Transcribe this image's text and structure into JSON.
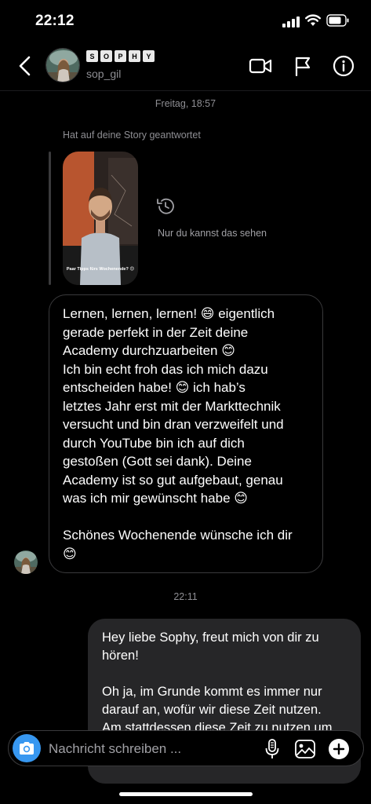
{
  "status_bar": {
    "time": "22:12"
  },
  "header": {
    "display_name_letters": [
      "S",
      "O",
      "P",
      "H",
      "Y"
    ],
    "username": "sop_gil",
    "icons": [
      "chevron-left-icon",
      "video-camera-icon",
      "flag-icon",
      "info-icon"
    ]
  },
  "chat": {
    "timestamp_1": "Freitag, 18:57",
    "story_reply_label": "Hat auf deine Story geantwortet",
    "story_caption": "Paar Tipps fürs Wochenende? 😊",
    "only_you_text": "Nur du kannst das sehen",
    "received_message": {
      "para1_lines": [
        "Lernen, lernen, lernen! 😄 eigentlich",
        "gerade perfekt in der Zeit deine",
        "Academy durchzuarbeiten 😊",
        "Ich bin echt froh das ich mich dazu",
        "entscheiden habe! 😊 ich hab’s",
        "letztes Jahr erst mit der Markttechnik",
        "versucht und bin dran verzweifelt und",
        "durch YouTube bin ich auf dich",
        "gestoßen (Gott sei dank). Deine",
        "Academy ist so gut aufgebaut, genau",
        "was ich mir gewünscht habe 😊"
      ],
      "para2_lines": [
        "Schönes Wochenende wünsche ich dir",
        "😊"
      ]
    },
    "timestamp_2": "22:11",
    "sent_message": {
      "para1_lines": [
        "Hey liebe Sophy, freut mich von dir zu",
        "hören!"
      ],
      "para2_lines": [
        "Oh ja, im Grunde kommt es immer nur",
        "darauf an, wofür wir diese Zeit nutzen.",
        "Am stattdessen diese Zeit zu nutzen um"
      ]
    }
  },
  "composer": {
    "placeholder": "Nachricht schreiben ...",
    "value": ""
  },
  "colors": {
    "background": "#000000",
    "accent": "#3797f0",
    "sent_bubble": "#262628",
    "bubble_border": "#3a3a3c",
    "muted_text": "#8e8e93"
  }
}
